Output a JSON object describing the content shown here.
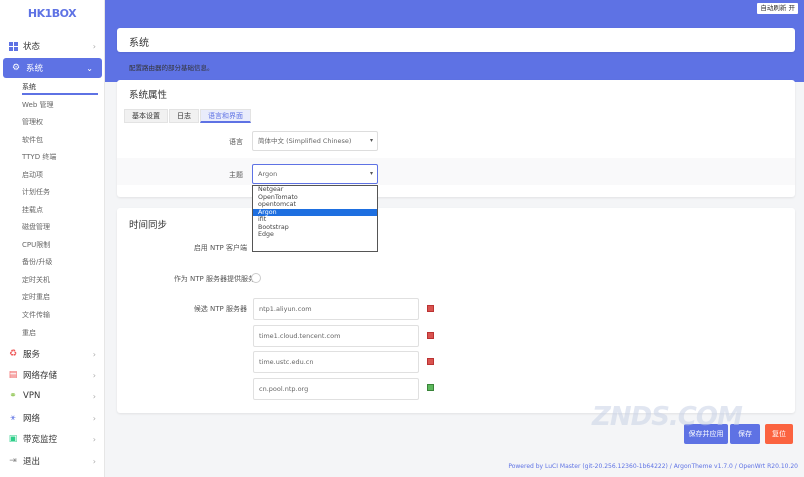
{
  "brand": {
    "logo_text": "HK1BOX",
    "accent": "#5e72e4"
  },
  "topbar": {
    "refresh_label": "自动刷新 开"
  },
  "sidebar": {
    "items": [
      {
        "label": "状态",
        "icon": "grid-icon"
      },
      {
        "label": "系统",
        "icon": "gear-icon"
      },
      {
        "label": "服务",
        "icon": "puzzle-icon"
      },
      {
        "label": "网络存储",
        "icon": "storage-icon"
      },
      {
        "label": "VPN",
        "icon": "vpn-icon"
      },
      {
        "label": "网络",
        "icon": "network-icon"
      },
      {
        "label": "带宽监控",
        "icon": "monitor-icon"
      },
      {
        "label": "退出",
        "icon": "logout-icon"
      }
    ],
    "sub_items": [
      "系统",
      "Web 管理",
      "管理权",
      "软件包",
      "TTYD 终端",
      "启动项",
      "计划任务",
      "挂载点",
      "磁盘管理",
      "CPU限制",
      "备份/升级",
      "定时关机",
      "定时重启",
      "文件传输",
      "重启"
    ]
  },
  "page": {
    "title": "系统",
    "description": "配置路由器的部分基础信息。"
  },
  "system_props": {
    "title": "系统属性",
    "tabs": [
      "基本设置",
      "日志",
      "语言和界面"
    ],
    "language_label": "语言",
    "language_value": "简体中文 (Simplified Chinese)",
    "theme_label": "主题",
    "theme_value": "Argon",
    "theme_options": [
      "Netgear",
      "OpenTomato",
      "opentomcat",
      "Argon",
      "ifit",
      "Bootstrap",
      "Edge"
    ]
  },
  "time_sync": {
    "title": "时间同步",
    "enable_ntp_label": "启用 NTP 客户端",
    "ntp_server_label": "作为 NTP 服务器提供服务",
    "candidate_label": "候选 NTP 服务器",
    "servers": [
      "ntp1.aliyun.com",
      "time1.cloud.tencent.com",
      "time.ustc.edu.cn",
      "cn.pool.ntp.org"
    ]
  },
  "actions": {
    "save_apply": "保存并应用",
    "save": "保存",
    "reset": "复位"
  },
  "footer": {
    "powered": "Powered by LuCI Master (git-20.256.12360-1b64222) / ArgonTheme v1.7.0 / OpenWrt R20.10.20"
  },
  "watermark": "ZNDS.COM"
}
